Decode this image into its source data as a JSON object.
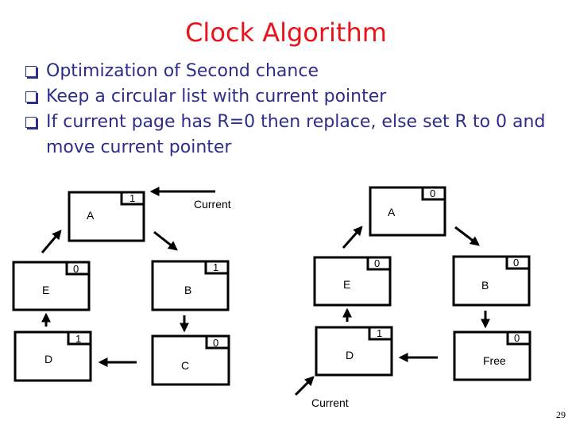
{
  "slide": {
    "title": "Clock Algorithm",
    "bullets": [
      "Optimization of Second chance",
      "Keep a circular list with current pointer",
      "If current page has R=0 then replace, else set R to 0 and move current pointer"
    ],
    "page_number": "29"
  },
  "diagrams": {
    "before": {
      "pages": [
        {
          "label": "A",
          "r_bit": "1"
        },
        {
          "label": "B",
          "r_bit": "1"
        },
        {
          "label": "C",
          "r_bit": "0"
        },
        {
          "label": "D",
          "r_bit": "1"
        },
        {
          "label": "E",
          "r_bit": "0"
        }
      ],
      "pointer_label": "Current",
      "pointer_target": "A"
    },
    "after": {
      "pages": [
        {
          "label": "A",
          "r_bit": "0"
        },
        {
          "label": "B",
          "r_bit": "0"
        },
        {
          "label": "Free",
          "r_bit": "0"
        },
        {
          "label": "D",
          "r_bit": "1"
        },
        {
          "label": "E",
          "r_bit": "0"
        }
      ],
      "pointer_label": "Current",
      "pointer_target": "D"
    }
  }
}
